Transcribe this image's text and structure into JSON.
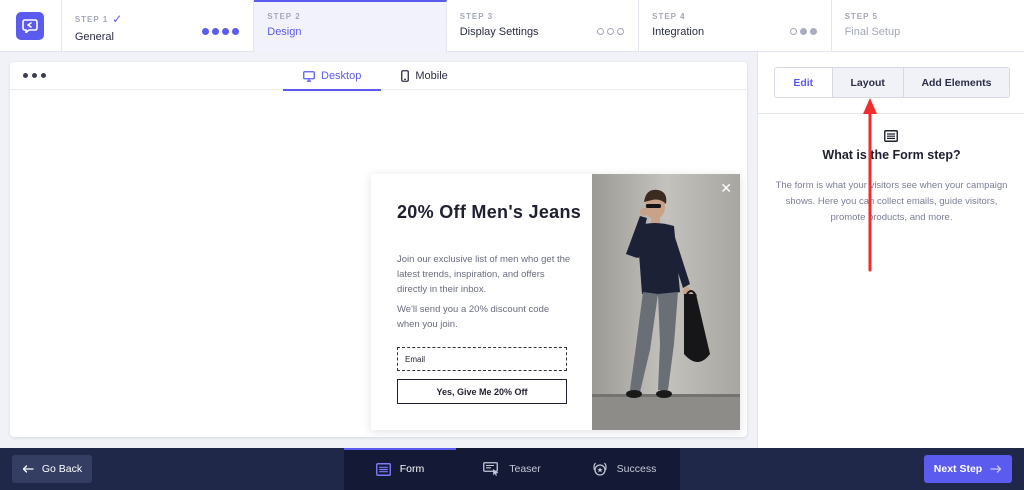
{
  "stepper": {
    "steps": [
      {
        "num": "STEP 1",
        "name": "General",
        "completed": true
      },
      {
        "num": "STEP 2",
        "name": "Design"
      },
      {
        "num": "STEP 3",
        "name": "Display Settings"
      },
      {
        "num": "STEP 4",
        "name": "Integration"
      },
      {
        "num": "STEP 5",
        "name": "Final Setup"
      }
    ],
    "check_glyph": "✓"
  },
  "canvas": {
    "tabs": [
      {
        "label": "Desktop",
        "icon": "desktop-icon",
        "active": true
      },
      {
        "label": "Mobile",
        "icon": "mobile-icon"
      }
    ]
  },
  "popup": {
    "title": "20% Off Men's Jeans",
    "description": "Join our exclusive list of men who get the latest trends, inspiration, and offers directly in their inbox.",
    "description2": "We'll send you a 20% discount code when you join.",
    "email_placeholder": "Email",
    "cta_label": "Yes, Give Me 20% Off",
    "close_glyph": "✕"
  },
  "panel": {
    "tabs": [
      {
        "label": "Edit",
        "active": true
      },
      {
        "label": "Layout"
      },
      {
        "label": "Add Elements"
      }
    ],
    "heading": "What is the Form step?",
    "text": "The form is what your visitors see when your campaign shows. Here you can collect emails, guide visitors, promote products, and more."
  },
  "bottom": {
    "back_label": "Go Back",
    "tabs": [
      {
        "label": "Form",
        "icon": "form-icon",
        "active": true
      },
      {
        "label": "Teaser",
        "icon": "teaser-icon"
      },
      {
        "label": "Success",
        "icon": "success-icon"
      }
    ],
    "next_label": "Next Step"
  },
  "colors": {
    "accent": "#5b5bf0",
    "bottom_bar": "#20284a",
    "annotation_arrow": "#f02d2d"
  }
}
